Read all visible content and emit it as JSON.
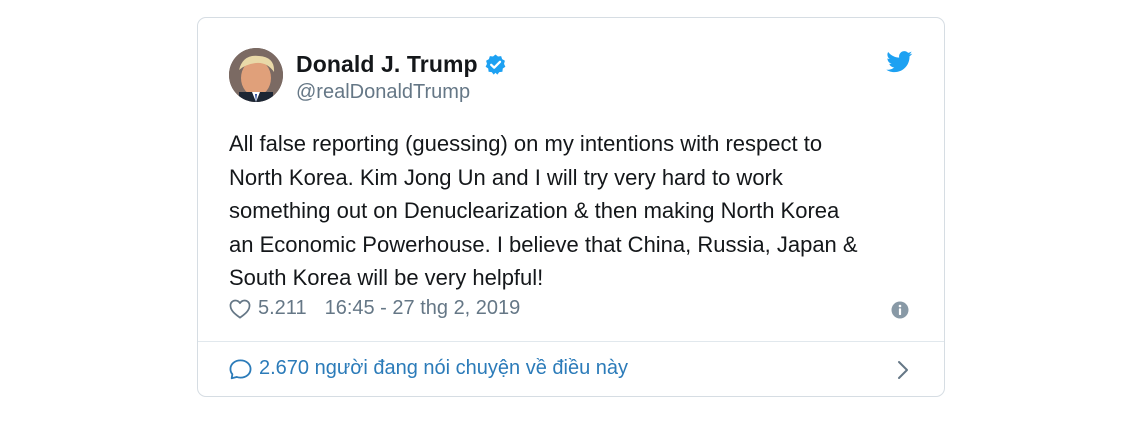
{
  "tweet": {
    "display_name": "Donald J. Trump",
    "handle": "@realDonaldTrump",
    "verified": true,
    "text": "All false reporting (guessing) on my intentions with respect to\nNorth Korea. Kim Jong Un and I will try very hard to work\nsomething out on Denuclearization & then making North Korea\nan Economic Powerhouse. I believe that China, Russia, Japan &\nSouth Korea will be very helpful!",
    "like_count": "5.211",
    "timestamp": "16:45 - 27 thg 2, 2019",
    "conversation_label": "2.670 người đang nói chuyện về điều này"
  },
  "icons": {
    "brand": "twitter-bird-icon",
    "verified": "verified-badge-icon",
    "like": "heart-icon",
    "info": "info-icon",
    "reply": "speech-bubble-icon",
    "more": "chevron-right-icon"
  },
  "colors": {
    "accent": "#1da1f2",
    "link": "#2b7bb9",
    "text": "#14171a",
    "muted": "#657786",
    "border": "#d6dde3"
  }
}
